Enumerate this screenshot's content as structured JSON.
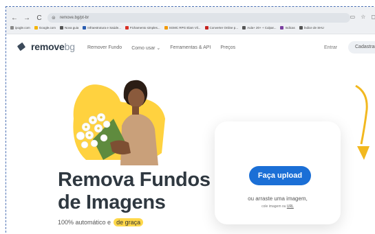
{
  "browser": {
    "nav": [
      "←",
      "→",
      "C",
      "⌂"
    ],
    "url": "remove.bg/pt-br",
    "bookmarks": [
      {
        "label": "ipogle.com",
        "color": "#888888"
      },
      {
        "label": "Google.com",
        "color": "#f4b400"
      },
      {
        "label": "Nova guia",
        "color": "#555555"
      },
      {
        "label": "Infraestrutura e Saúde...",
        "color": "#2a5db0"
      },
      {
        "label": "Fichamento simples...",
        "color": "#d93025"
      },
      {
        "label": "SGMC RPG Elam Vil...",
        "color": "#f29900"
      },
      {
        "label": "Converter Online p...",
        "color": "#c5221f"
      },
      {
        "label": "Aula+ 20+ + Culpar...",
        "color": "#555555"
      },
      {
        "label": "Indicas",
        "color": "#7b3fa0"
      },
      {
        "label": "Índice de SHU",
        "color": "#555555"
      }
    ]
  },
  "site": {
    "logo_main": "remove",
    "logo_suffix": "bg",
    "menu": [
      "Remover Fundo",
      "Como usar ⌄",
      "Ferramentas & API",
      "Preços"
    ],
    "login": "Entrar",
    "signup": "Cadastrar"
  },
  "hero": {
    "headline_line1": "Remova Fundos",
    "headline_line2": "de Imagens",
    "sub_prefix": "100% automático e",
    "sub_highlight": "de graça"
  },
  "upload": {
    "button": "Faça upload",
    "drop_text": "ou arraste uma imagem,",
    "url_prefix": "cole imagem ou",
    "url_link": "URL"
  },
  "colors": {
    "accent": "#1b6fd6",
    "highlight": "#ffd84a",
    "headline": "#2f3840"
  }
}
